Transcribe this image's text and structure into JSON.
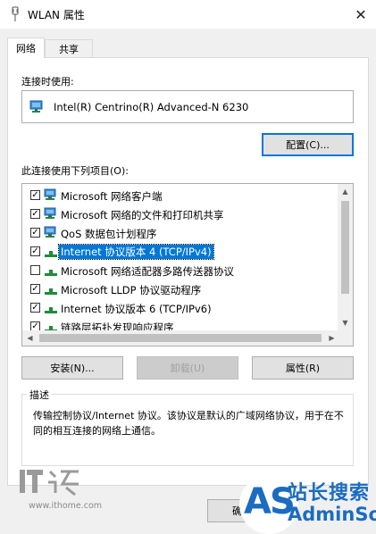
{
  "window": {
    "title": "WLAN 属性",
    "close_glyph": "✕"
  },
  "tabs": [
    {
      "label": "网络",
      "active": true
    },
    {
      "label": "共享",
      "active": false
    }
  ],
  "connect_using": {
    "label": "连接时使用:",
    "adapter": "Intel(R) Centrino(R) Advanced-N 6230",
    "configure_button": "配置(C)..."
  },
  "items_section": {
    "label": "此连接使用下列项目(O):",
    "items": [
      {
        "label": "Microsoft 网络客户端",
        "checked": true,
        "icon": "network-client-icon",
        "selected": false
      },
      {
        "label": "Microsoft 网络的文件和打印机共享",
        "checked": true,
        "icon": "network-client-icon",
        "selected": false
      },
      {
        "label": "QoS 数据包计划程序",
        "checked": true,
        "icon": "network-client-icon",
        "selected": false
      },
      {
        "label": "Internet 协议版本 4 (TCP/IPv4)",
        "checked": true,
        "icon": "protocol-icon",
        "selected": true
      },
      {
        "label": "Microsoft 网络适配器多路传送器协议",
        "checked": false,
        "icon": "protocol-icon",
        "selected": false
      },
      {
        "label": "Microsoft LLDP 协议驱动程序",
        "checked": true,
        "icon": "protocol-icon",
        "selected": false
      },
      {
        "label": "Internet 协议版本 6 (TCP/IPv6)",
        "checked": true,
        "icon": "protocol-icon",
        "selected": false
      },
      {
        "label": "链路层拓扑发现响应程序",
        "checked": true,
        "icon": "protocol-icon",
        "selected": false
      }
    ]
  },
  "actions": {
    "install": "安装(N)...",
    "uninstall": "卸载(U)",
    "properties": "属性(R)"
  },
  "description": {
    "title": "描述",
    "text": "传输控制协议/Internet 协议。该协议是默认的广域网络协议，用于在不同的相互连接的网络上通信。"
  },
  "footer": {
    "partial_button": "确"
  },
  "watermarks": {
    "ithome_url": "www.ithome.com",
    "ithome_logo_text": "IT之家",
    "site_logo_letters": "AS",
    "site_name_cn": "站长搜索",
    "site_name_en": "AdminSo"
  },
  "colors": {
    "accent": "#0078d7",
    "selection": "#0078d7",
    "button_face": "#e1e1e1",
    "logo_blue": "#1b6cc1"
  }
}
